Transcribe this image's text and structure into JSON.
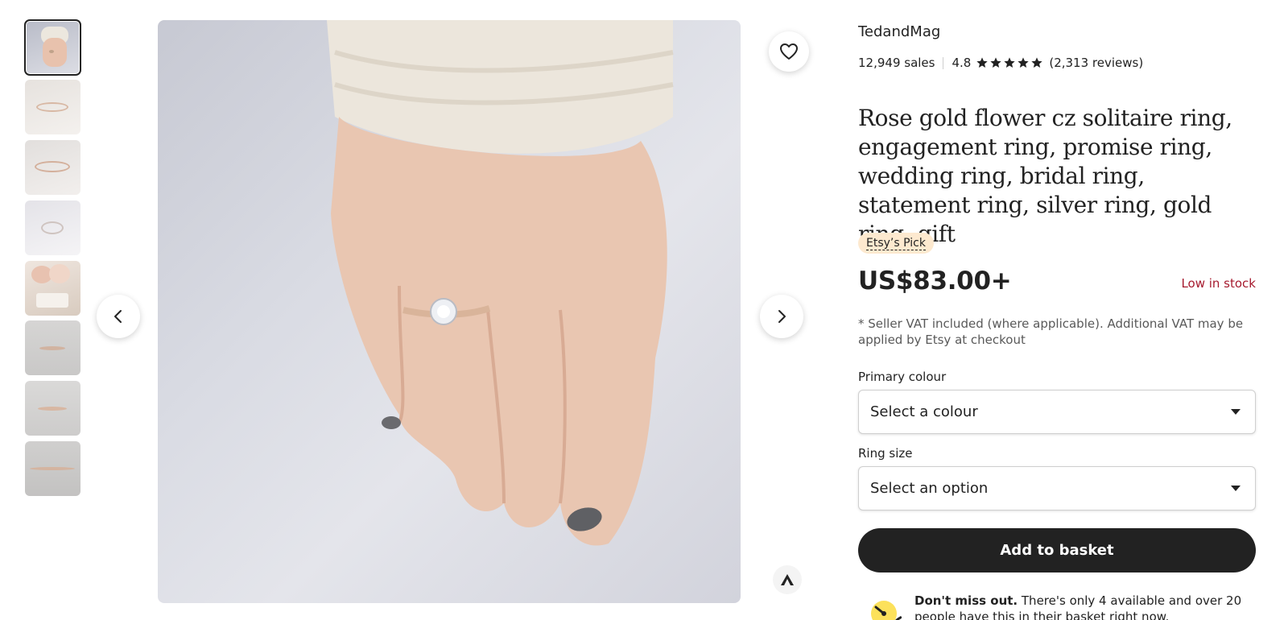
{
  "gallery": {
    "thumbnail_count": 8,
    "active_index": 0
  },
  "shop": {
    "name": "TedandMag",
    "sales": "12,949 sales",
    "rating": "4.8",
    "reviews": "(2,313 reviews)",
    "star_count": 5
  },
  "listing": {
    "title": "Rose gold flower cz solitaire ring, engagement ring, promise ring, wedding ring, bridal ring, statement ring, silver ring, gold ring, gift",
    "badge": "Etsy’s Pick",
    "price": "US$83.00+",
    "stock_status": "Low in stock",
    "vat_note": "* Seller VAT included (where applicable). Additional VAT may be applied by Etsy at checkout"
  },
  "options": {
    "primary_colour_label": "Primary colour",
    "primary_colour_value": "Select a colour",
    "ring_size_label": "Ring size",
    "ring_size_value": "Select an option"
  },
  "actions": {
    "add_to_basket": "Add to basket"
  },
  "notice": {
    "bold": "Don't miss out.",
    "text": " There's only 4 available and over 20 people have this in their basket right now."
  },
  "icons": {
    "favorite": "heart-icon",
    "prev": "chevron-left-icon",
    "next": "chevron-right-icon",
    "report": "flag-icon",
    "notice": "gauge-icon"
  },
  "colors": {
    "primary": "#222222",
    "stock_red": "#a61a2e",
    "badge_bg": "#fde9cf"
  }
}
